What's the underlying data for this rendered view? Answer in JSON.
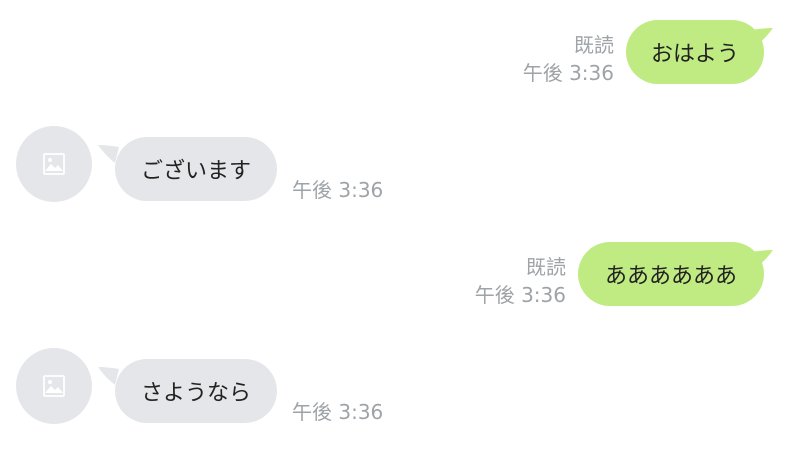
{
  "colors": {
    "sent_bubble": "#c0eb82",
    "received_bubble": "#e5e6e9",
    "meta_text": "#9ea3a8",
    "message_text": "#222222"
  },
  "messages": [
    {
      "direction": "sent",
      "text": "おはよう",
      "read_label": "既読",
      "time": "午後 3:36"
    },
    {
      "direction": "received",
      "text": "ございます",
      "time": "午後 3:36",
      "avatar_icon": "image-placeholder-icon"
    },
    {
      "direction": "sent",
      "text": "ああああああ",
      "read_label": "既読",
      "time": "午後 3:36"
    },
    {
      "direction": "received",
      "text": "さようなら",
      "time": "午後 3:36",
      "avatar_icon": "image-placeholder-icon"
    }
  ]
}
